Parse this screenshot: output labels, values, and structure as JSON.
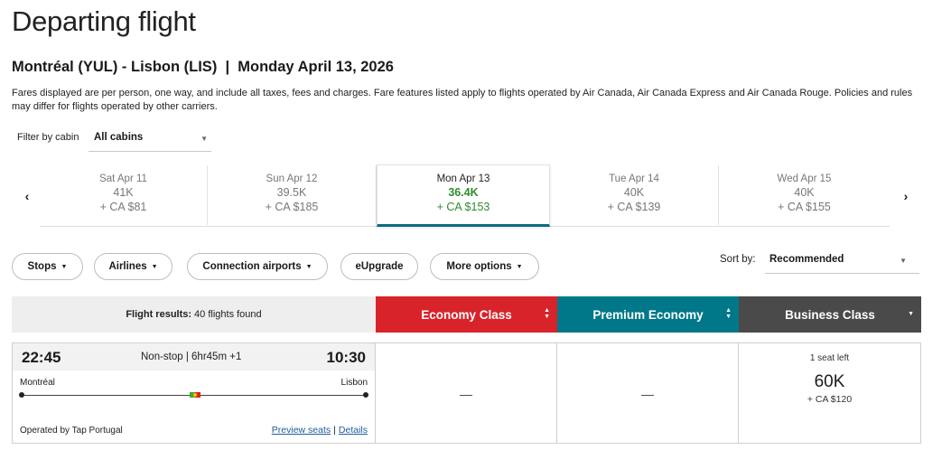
{
  "header": {
    "title": "Departing flight",
    "route": "Montréal (YUL) - Lisbon (LIS)  |  Monday April 13, 2026",
    "note": "Fares displayed are per person, one way, and include all taxes, fees and charges. Fare features listed apply to flights operated by Air Canada, Air Canada Express and Air Canada Rouge. Policies and rules may differ for flights operated by other carriers."
  },
  "filter": {
    "label": "Filter by cabin",
    "value": "All cabins"
  },
  "dates": [
    {
      "date": "Sat Apr 11",
      "points": "41K",
      "cash": "+ CA $81"
    },
    {
      "date": "Sun Apr 12",
      "points": "39.5K",
      "cash": "+ CA $185"
    },
    {
      "date": "Mon Apr 13",
      "points": "36.4K",
      "cash": "+ CA $153"
    },
    {
      "date": "Tue Apr 14",
      "points": "40K",
      "cash": "+ CA $139"
    },
    {
      "date": "Wed Apr 15",
      "points": "40K",
      "cash": "+ CA $155"
    }
  ],
  "filters": {
    "stops": "Stops",
    "airlines": "Airlines",
    "connection": "Connection airports",
    "eupgrade": "eUpgrade",
    "more": "More options"
  },
  "sort": {
    "label": "Sort by:",
    "value": "Recommended"
  },
  "results": {
    "label": "Flight results:",
    "count": "40 flights found"
  },
  "cabins": [
    {
      "name": "Economy Class",
      "color": "#d8232a"
    },
    {
      "name": "Premium Economy",
      "color": "#00788a"
    },
    {
      "name": "Business Class",
      "color": "#4a4a4a"
    }
  ],
  "flight": {
    "departure": "22:45",
    "arrival": "10:30",
    "duration": "Non-stop | 6hr45m +1",
    "from": "Montréal",
    "to": "Lisbon",
    "operated_by": "Operated by Tap Portugal",
    "preview_seats": "Preview seats",
    "details": "Details",
    "economy": "—",
    "premium": "—",
    "business": {
      "seats": "1 seat left",
      "points": "60K",
      "cash": "+ CA $120"
    }
  },
  "colors": {
    "active_date": "#0b6a85",
    "price_green": "#2f8c2f",
    "link": "#1d5c9c"
  }
}
